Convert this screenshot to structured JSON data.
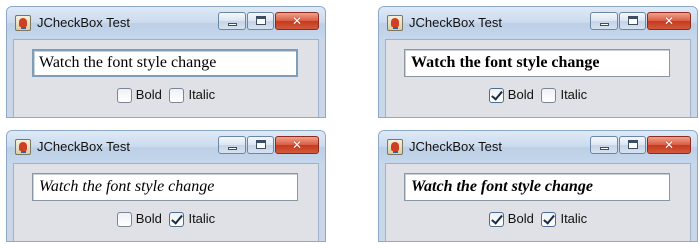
{
  "windows": [
    {
      "title": "JCheckBox Test",
      "text_value": "Watch the font style change",
      "bold": {
        "label": "Bold",
        "checked": false
      },
      "italic": {
        "label": "Italic",
        "checked": false
      }
    },
    {
      "title": "JCheckBox Test",
      "text_value": "Watch the font style change",
      "bold": {
        "label": "Bold",
        "checked": true
      },
      "italic": {
        "label": "Italic",
        "checked": false
      }
    },
    {
      "title": "JCheckBox Test",
      "text_value": "Watch the font style change",
      "bold": {
        "label": "Bold",
        "checked": false
      },
      "italic": {
        "label": "Italic",
        "checked": true
      }
    },
    {
      "title": "JCheckBox Test",
      "text_value": "Watch the font style change",
      "bold": {
        "label": "Bold",
        "checked": true
      },
      "italic": {
        "label": "Italic",
        "checked": true
      }
    }
  ],
  "icons": {
    "app": "java-cup-icon",
    "minimize": "minimize-icon",
    "maximize": "maximize-icon",
    "close": "close-icon",
    "close_glyph": "✕"
  },
  "colors": {
    "close_button": "#c43a20",
    "title_bar": "#cbdbee",
    "content_background": "#e0e1e6"
  }
}
